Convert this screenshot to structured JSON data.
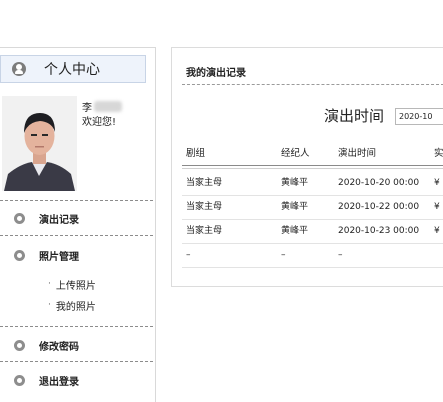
{
  "sidebar": {
    "header": {
      "title": "个人中心",
      "icon": "user-circle-icon"
    },
    "profile": {
      "name": "李",
      "welcome": "欢迎您!"
    },
    "menu": [
      {
        "label": "演出记录",
        "icon": "user-icon"
      },
      {
        "label": "照片管理",
        "icon": "wrench-icon"
      },
      {
        "label": "修改密码",
        "icon": "lock-icon"
      },
      {
        "label": "退出登录",
        "icon": "exit-icon"
      }
    ],
    "photo_submenu": [
      {
        "label": "上传照片"
      },
      {
        "label": "我的照片"
      }
    ]
  },
  "main": {
    "title": "我的演出记录",
    "filter": {
      "label": "演出时间",
      "value": "2020-10"
    },
    "table": {
      "columns": [
        "剧组",
        "经纪人",
        "演出时间",
        "实"
      ],
      "rows": [
        [
          "当家主母",
          "黄峰平",
          "2020-10-20 00:00",
          "¥"
        ],
        [
          "当家主母",
          "黄峰平",
          "2020-10-22 00:00",
          "¥"
        ],
        [
          "当家主母",
          "黄峰平",
          "2020-10-23 00:00",
          "¥"
        ],
        [
          "–",
          "–",
          "–",
          ""
        ]
      ]
    }
  }
}
